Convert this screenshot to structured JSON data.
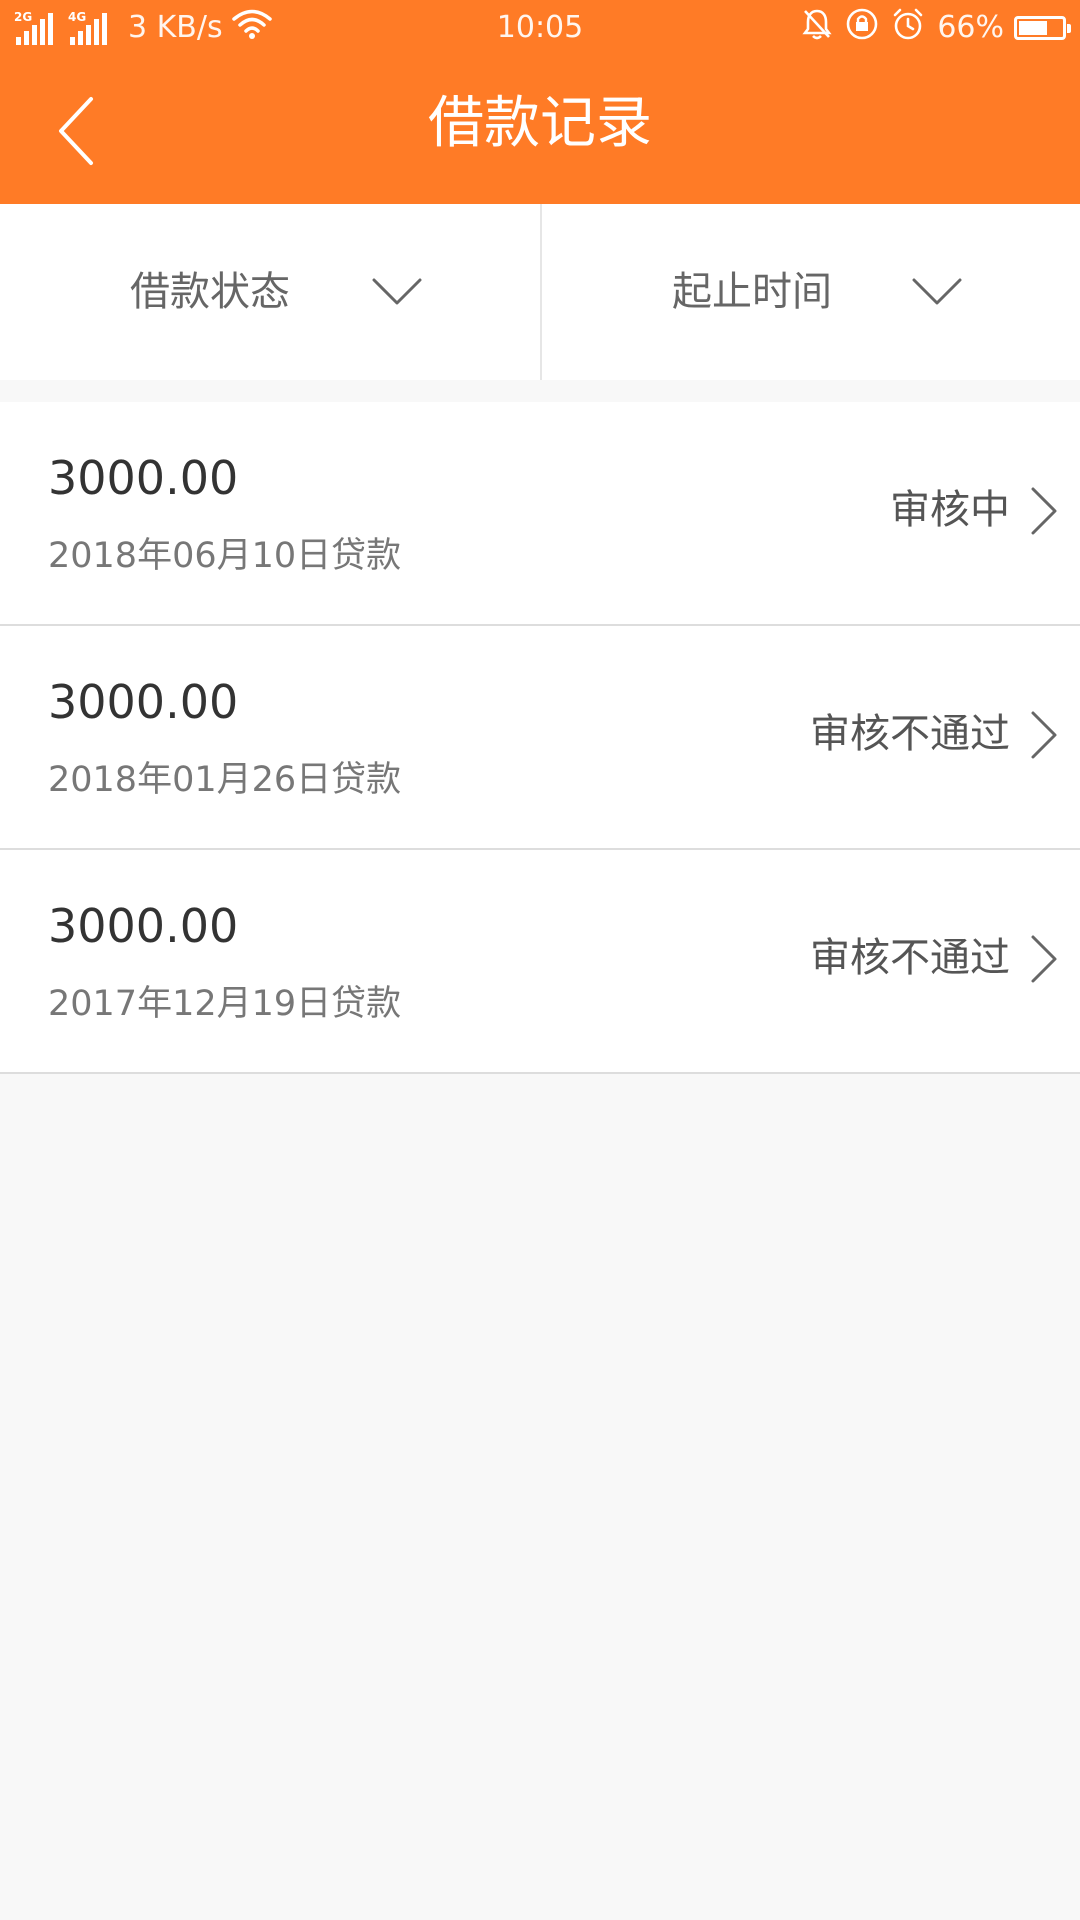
{
  "status_bar": {
    "sim1_tag": "2G",
    "sim2_tag": "4G",
    "speed": "3 KB/s",
    "time": "10:05",
    "battery": "66%",
    "battery_level": 0.66,
    "icons": [
      "signal-icon",
      "wifi-icon",
      "mute-bell-icon",
      "lock-rotation-icon",
      "alarm-icon",
      "battery-icon"
    ]
  },
  "nav": {
    "title": "借款记录",
    "back_icon": "back-arrow-icon"
  },
  "filters": [
    {
      "label": "借款状态",
      "icon": "chevron-down-icon"
    },
    {
      "label": "起止时间",
      "icon": "chevron-down-icon"
    }
  ],
  "records": [
    {
      "amount": "3000.00",
      "date": "2018年06月10日贷款",
      "status": "审核中"
    },
    {
      "amount": "3000.00",
      "date": "2018年01月26日贷款",
      "status": "审核不通过"
    },
    {
      "amount": "3000.00",
      "date": "2017年12月19日贷款",
      "status": "审核不通过"
    }
  ],
  "colors": {
    "header": "#ff7b26",
    "background": "#f8f8f8",
    "card": "#ffffff",
    "divider": "#dddddd"
  }
}
